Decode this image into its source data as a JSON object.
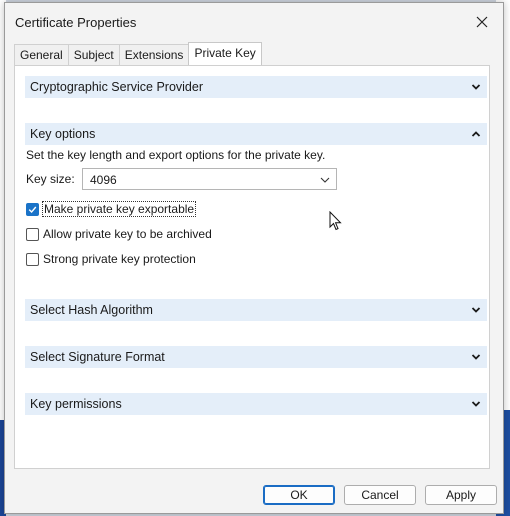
{
  "window": {
    "title": "Certificate Properties"
  },
  "tabs": [
    {
      "label": "General"
    },
    {
      "label": "Subject"
    },
    {
      "label": "Extensions"
    },
    {
      "label": "Private Key"
    }
  ],
  "active_tab": "Private Key",
  "sections": {
    "csp": {
      "label": "Cryptographic Service Provider",
      "expanded": false
    },
    "key_options": {
      "label": "Key options",
      "expanded": true
    },
    "hash": {
      "label": "Select Hash Algorithm",
      "expanded": false
    },
    "signature": {
      "label": "Select Signature Format",
      "expanded": false
    },
    "permissions": {
      "label": "Key permissions",
      "expanded": false
    }
  },
  "key_options": {
    "description": "Set the key length and export options for the private key.",
    "key_size_label": "Key size:",
    "key_size_value": "4096",
    "checkboxes": [
      {
        "label": "Make private key exportable",
        "checked": true
      },
      {
        "label": "Allow private key to be archived",
        "checked": false
      },
      {
        "label": "Strong private key protection",
        "checked": false
      }
    ]
  },
  "buttons": {
    "ok": "OK",
    "cancel": "Cancel",
    "apply": "Apply"
  },
  "colors": {
    "section_header": "#e4eef9",
    "accent": "#1a73c8"
  },
  "icons": {
    "close": "close-icon",
    "collapsed": "chevron-down-icon",
    "expanded": "chevron-up-icon",
    "dropdown": "chevron-down-icon",
    "check": "checkmark-icon"
  }
}
